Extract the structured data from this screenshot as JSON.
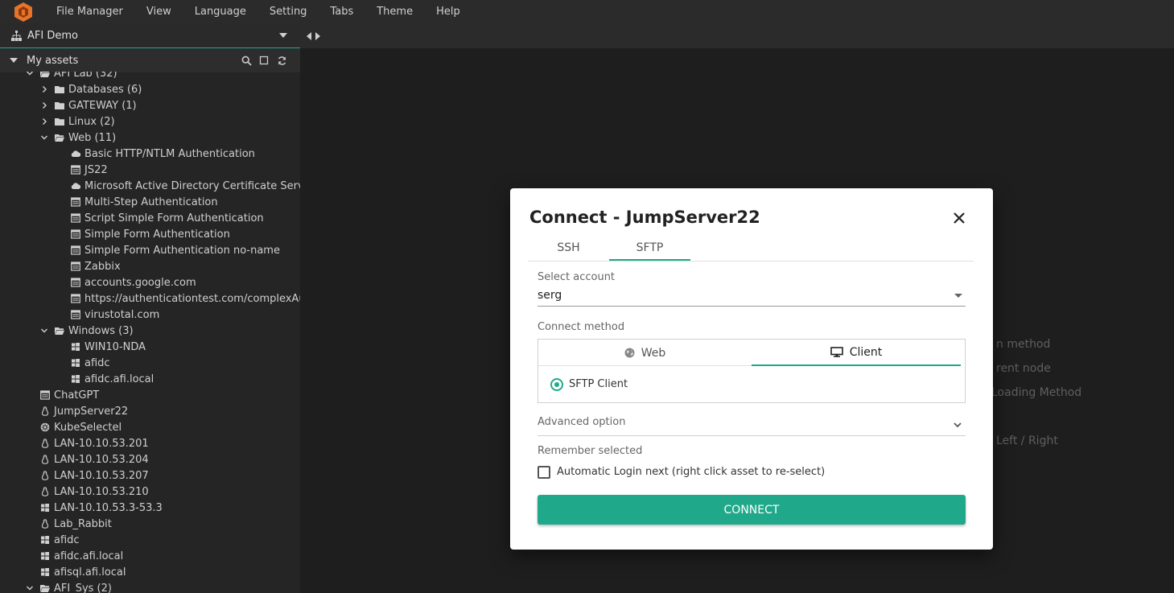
{
  "menubar": {
    "items": [
      "File Manager",
      "View",
      "Language",
      "Setting",
      "Tabs",
      "Theme",
      "Help"
    ]
  },
  "sidebar": {
    "workspace": "AFI Demo",
    "assets_label": "My assets",
    "tree": [
      {
        "label": "AFI Lab (32)",
        "level": 1,
        "type": "folder-open",
        "twisty": "open"
      },
      {
        "label": "Databases (6)",
        "level": 2,
        "type": "folder",
        "twisty": "closed"
      },
      {
        "label": "GATEWAY (1)",
        "level": 2,
        "type": "folder",
        "twisty": "closed"
      },
      {
        "label": "Linux (2)",
        "level": 2,
        "type": "folder",
        "twisty": "closed"
      },
      {
        "label": "Web (11)",
        "level": 2,
        "type": "folder-open",
        "twisty": "open"
      },
      {
        "label": "Basic HTTP/NTLM Authentication",
        "level": 3,
        "type": "cloud"
      },
      {
        "label": "JS22",
        "level": 3,
        "type": "web"
      },
      {
        "label": "Microsoft Active Directory Certificate Service",
        "level": 3,
        "type": "cloud"
      },
      {
        "label": "Multi-Step Authentication",
        "level": 3,
        "type": "web"
      },
      {
        "label": "Script Simple Form Authentication",
        "level": 3,
        "type": "web"
      },
      {
        "label": "Simple Form Authentication",
        "level": 3,
        "type": "web"
      },
      {
        "label": "Simple Form Authentication no-name",
        "level": 3,
        "type": "web"
      },
      {
        "label": "Zabbix",
        "level": 3,
        "type": "web"
      },
      {
        "label": "accounts.google.com",
        "level": 3,
        "type": "web"
      },
      {
        "label": "https://authenticationtest.com/complexAuth",
        "level": 3,
        "type": "web"
      },
      {
        "label": "virustotal.com",
        "level": 3,
        "type": "web"
      },
      {
        "label": "Windows (3)",
        "level": 2,
        "type": "folder-open",
        "twisty": "open"
      },
      {
        "label": "WIN10-NDA",
        "level": 3,
        "type": "windows"
      },
      {
        "label": "afidc",
        "level": 3,
        "type": "windows"
      },
      {
        "label": "afidc.afi.local",
        "level": 3,
        "type": "windows"
      },
      {
        "label": "ChatGPT",
        "level": 2,
        "type": "web"
      },
      {
        "label": "JumpServer22",
        "level": 2,
        "type": "linux"
      },
      {
        "label": "KubeSelectel",
        "level": 2,
        "type": "kube"
      },
      {
        "label": "LAN-10.10.53.201",
        "level": 2,
        "type": "linux"
      },
      {
        "label": "LAN-10.10.53.204",
        "level": 2,
        "type": "linux"
      },
      {
        "label": "LAN-10.10.53.207",
        "level": 2,
        "type": "linux"
      },
      {
        "label": "LAN-10.10.53.210",
        "level": 2,
        "type": "linux"
      },
      {
        "label": "LAN-10.10.53.3-53.3",
        "level": 2,
        "type": "windows"
      },
      {
        "label": "Lab_Rabbit",
        "level": 2,
        "type": "linux"
      },
      {
        "label": "afidc",
        "level": 2,
        "type": "windows"
      },
      {
        "label": "afidc.afi.local",
        "level": 2,
        "type": "windows"
      },
      {
        "label": "afisql.afi.local",
        "level": 2,
        "type": "windows"
      },
      {
        "label": "AFI_Sys (2)",
        "level": 1,
        "type": "folder-open",
        "twisty": "open"
      }
    ]
  },
  "main": {
    "hints": [
      "n method",
      "rent node",
      "Loading Method",
      "Left / Right"
    ]
  },
  "dialog": {
    "title": "Connect - JumpServer22",
    "tabs": [
      "SSH",
      "SFTP"
    ],
    "active_tab": "SFTP",
    "select_account_label": "Select account",
    "account_value": "serg",
    "connect_method_label": "Connect method",
    "method_tabs": [
      "Web",
      "Client"
    ],
    "active_method": "Client",
    "radio_option": "SFTP Client",
    "advanced_label": "Advanced option",
    "remember_label": "Remember selected",
    "auto_login_label": "Automatic Login next (right click asset to re-select)",
    "connect_button": "CONNECT"
  },
  "colors": {
    "accent": "#1fa98a",
    "logo": "#e8742a"
  }
}
